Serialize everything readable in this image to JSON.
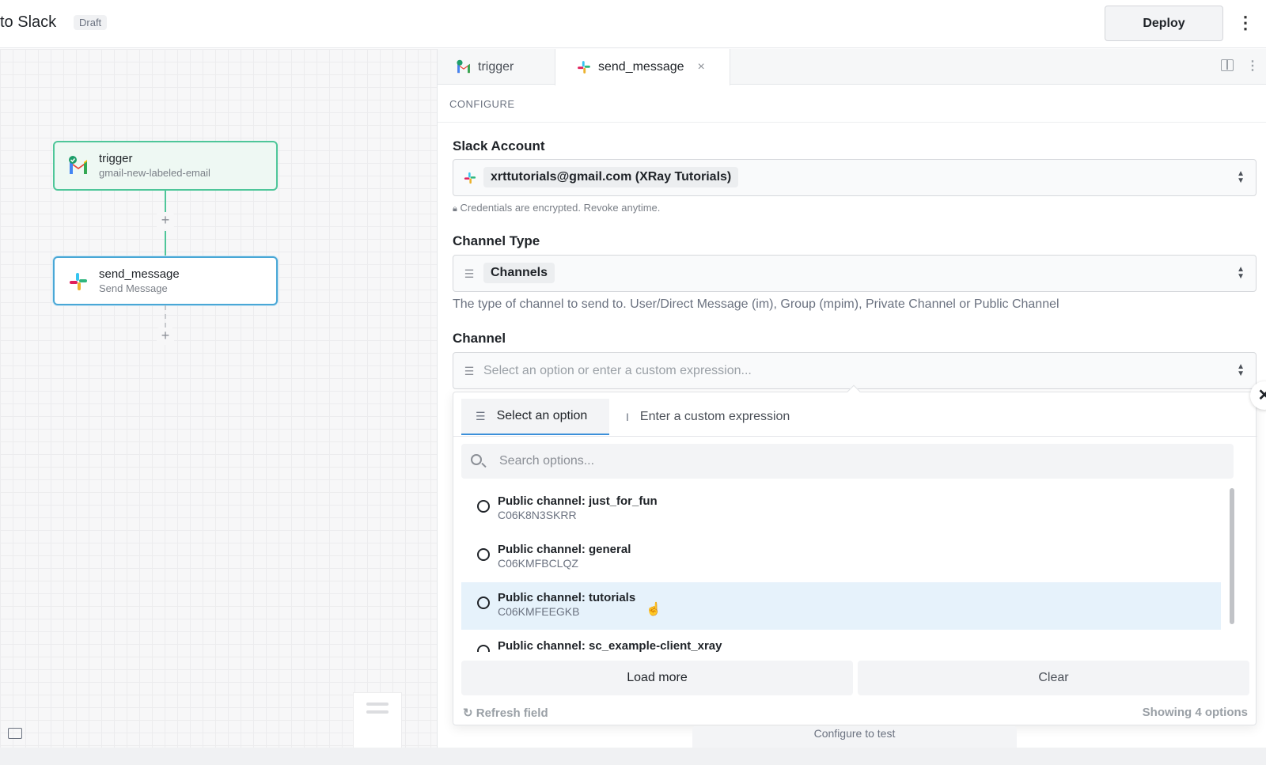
{
  "header": {
    "title": "to Slack",
    "status_badge": "Draft",
    "deploy_label": "Deploy"
  },
  "canvas": {
    "nodes": [
      {
        "name": "trigger",
        "subtitle": "gmail-new-labeled-email",
        "icon": "gmail-icon"
      },
      {
        "name": "send_message",
        "subtitle": "Send Message",
        "icon": "slack-icon"
      }
    ],
    "add_step_label": "+"
  },
  "panel": {
    "tabs": [
      {
        "label": "trigger",
        "icon": "gmail-icon"
      },
      {
        "label": "send_message",
        "icon": "slack-icon",
        "close": "×"
      }
    ],
    "section_label": "CONFIGURE",
    "slack_account": {
      "label": "Slack Account",
      "value": "xrttutorials@gmail.com (XRay Tutorials)",
      "help": "Credentials are encrypted. Revoke anytime."
    },
    "channel_type": {
      "label": "Channel Type",
      "value": "Channels",
      "description": "The type of channel to send to. User/Direct Message (im), Group (mpim), Private Channel or Public Channel"
    },
    "channel": {
      "label": "Channel",
      "placeholder": "Select an option or enter a custom expression..."
    }
  },
  "dropdown": {
    "tab_select": "Select an option",
    "tab_custom": "Enter a custom expression",
    "search_placeholder": "Search options...",
    "options": [
      {
        "name": "Public channel: just_for_fun",
        "id": "C06K8N3SKRR"
      },
      {
        "name": "Public channel: general",
        "id": "C06KMFBCLQZ"
      },
      {
        "name": "Public channel: tutorials",
        "id": "C06KMFEEGKB"
      },
      {
        "name": "Public channel: sc_example-client_xray",
        "id": ""
      }
    ],
    "load_more": "Load more",
    "clear": "Clear",
    "refresh": "Refresh field",
    "showing": "Showing 4 options"
  },
  "footer": {
    "peek_label": "Configure to test"
  },
  "colors": {
    "accent": "#3b8fd9",
    "trigger_border": "#4ec699",
    "hover_row": "#e6f2fb"
  }
}
